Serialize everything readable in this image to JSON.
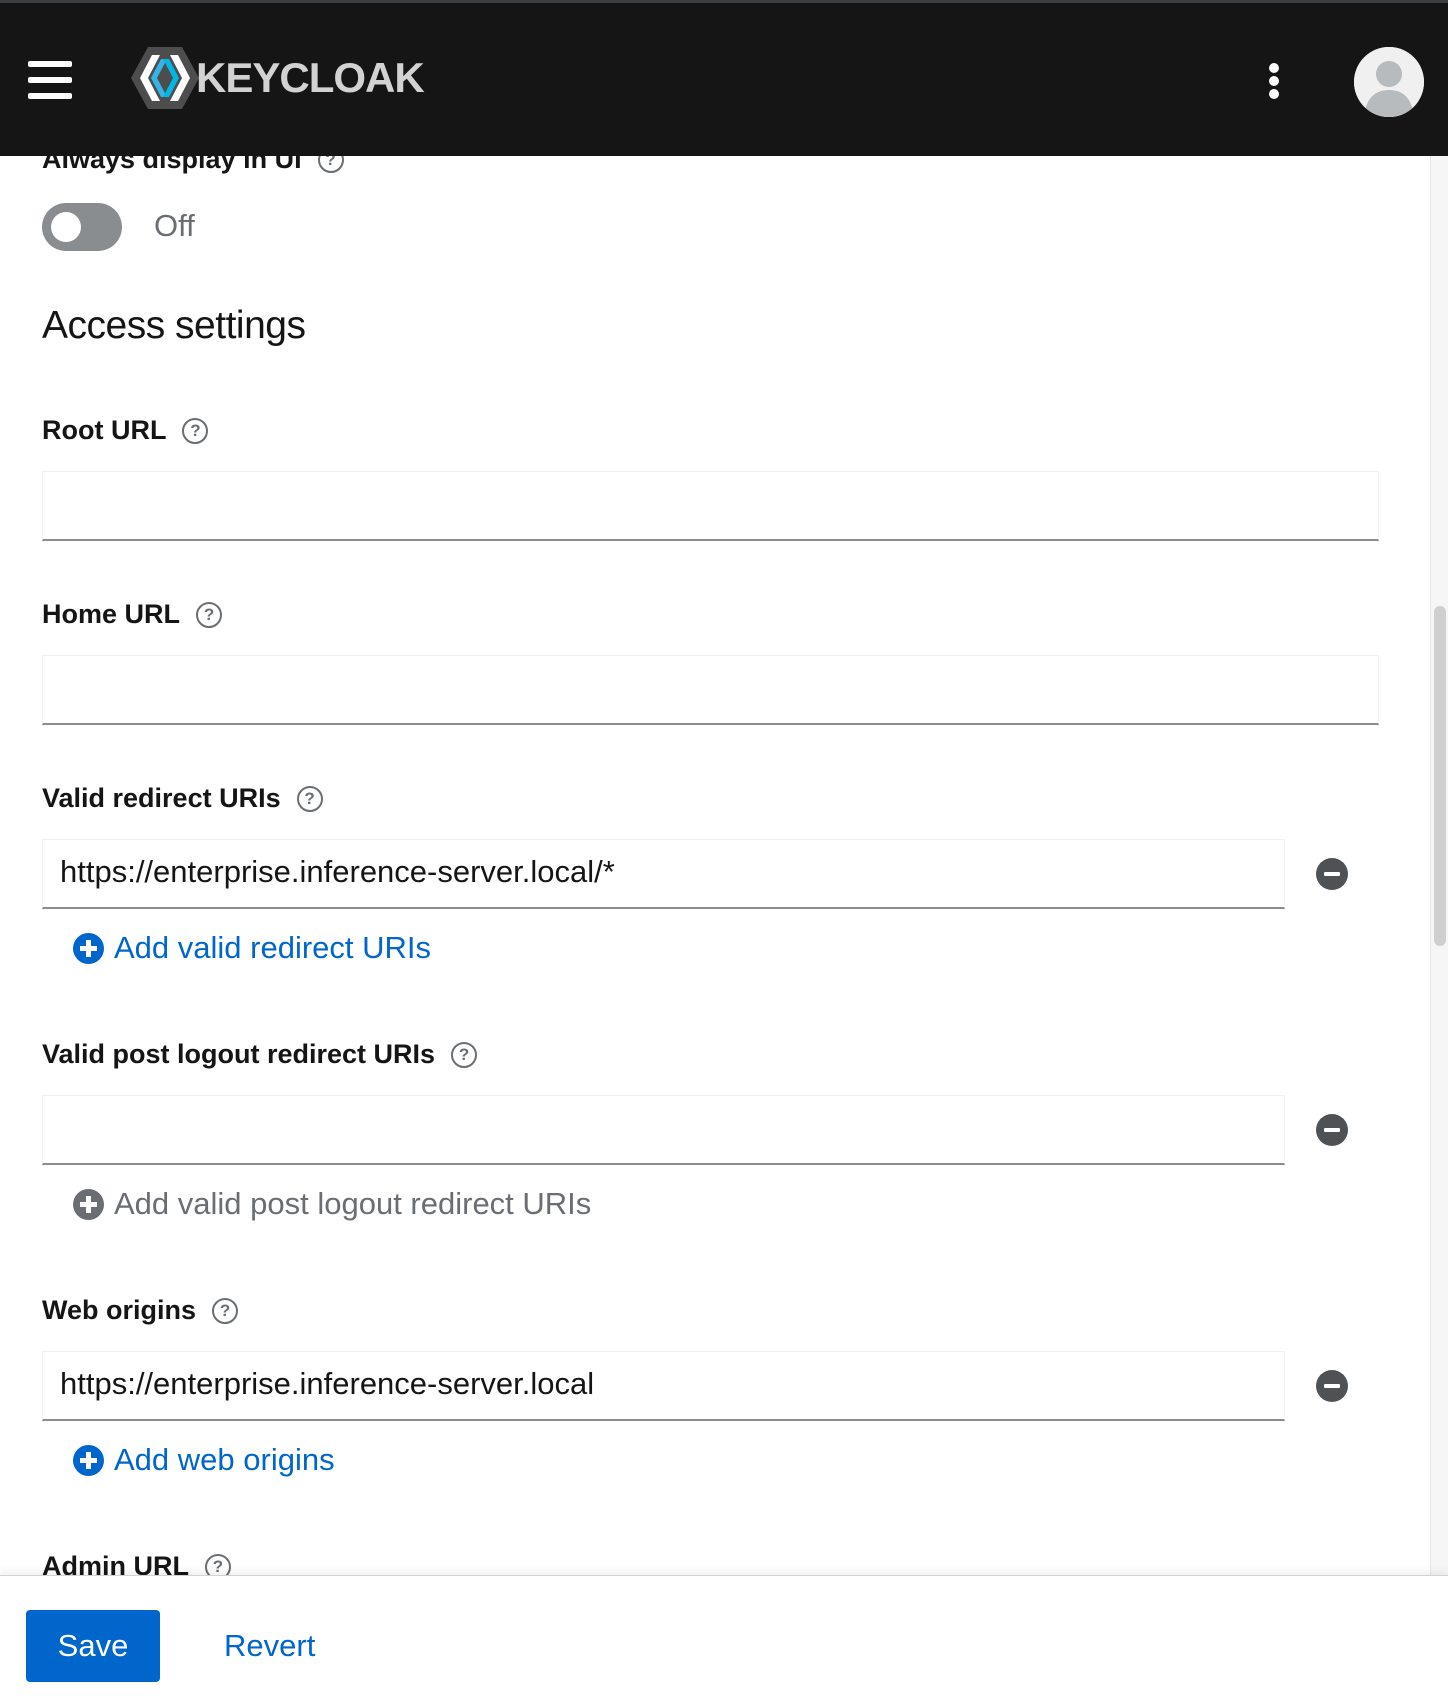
{
  "header": {
    "logo_text": "KEYCLOAK",
    "brand_colors": {
      "bar": "#151515",
      "logo_blue": "#33b5e5",
      "logo_dark": "#4d4d4d"
    }
  },
  "always_display": {
    "label": "Always display in UI",
    "state_label": "Off",
    "enabled": false
  },
  "access_settings": {
    "title": "Access settings",
    "root_url": {
      "label": "Root URL",
      "value": ""
    },
    "home_url": {
      "label": "Home URL",
      "value": ""
    },
    "redirect_uris": {
      "label": "Valid redirect URIs",
      "values": [
        "https://enterprise.inference-server.local/*"
      ],
      "add_label": "Add valid redirect URIs"
    },
    "post_logout_uris": {
      "label": "Valid post logout redirect URIs",
      "values": [
        ""
      ],
      "add_label": "Add valid post logout redirect URIs"
    },
    "web_origins": {
      "label": "Web origins",
      "values": [
        "https://enterprise.inference-server.local"
      ],
      "add_label": "Add web origins"
    },
    "admin_url": {
      "label": "Admin URL"
    }
  },
  "footer": {
    "save_label": "Save",
    "revert_label": "Revert"
  },
  "help_glyph": "?",
  "colors": {
    "link": "#0066cc",
    "primary": "#0066cc",
    "muted": "#6a6e73"
  }
}
